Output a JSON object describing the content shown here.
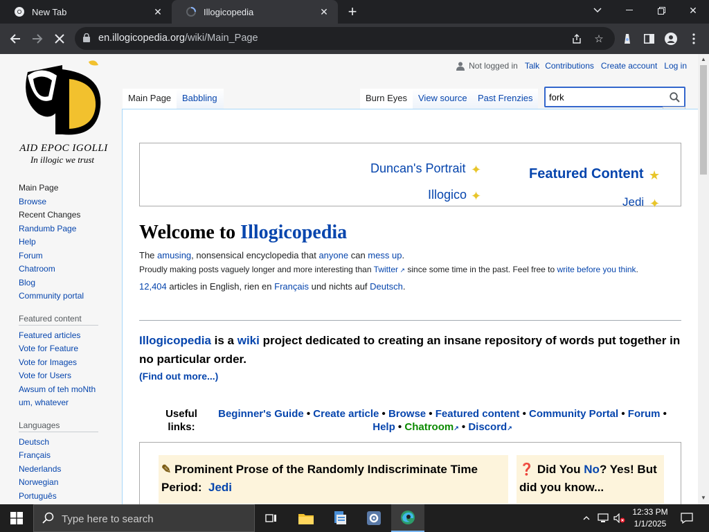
{
  "browser": {
    "tabs": [
      {
        "title": "New Tab"
      },
      {
        "title": "Illogicopedia"
      }
    ],
    "url": {
      "host": "en.illogicopedia.org",
      "path": "/wiki/Main_Page"
    }
  },
  "logo": {
    "motto": "AID EPOC IGOLLI",
    "tagline": "In illogic we trust"
  },
  "sidebar": {
    "nav": [
      "Main Page",
      "Browse",
      "Recent Changes",
      "Randumb Page",
      "Help",
      "Forum",
      "Chatroom",
      "Blog",
      "Community portal"
    ],
    "featured_header": "Featured content",
    "featured": [
      "Featured articles",
      "Vote for Feature",
      "Vote for Images",
      "Vote for Users",
      "Awsum of teh moNth",
      "um, whatever"
    ],
    "languages_header": "Languages",
    "languages": [
      "Deutsch",
      "Français",
      "Nederlands",
      "Norwegian",
      "Português"
    ]
  },
  "personal": {
    "not_logged_in": "Not logged in",
    "talk": "Talk",
    "contributions": "Contributions",
    "create_account": "Create account",
    "log_in": "Log in"
  },
  "page_tabs": {
    "main_page": "Main Page",
    "babbling": "Babbling",
    "burn_eyes": "Burn Eyes",
    "view_source": "View source",
    "past_frenzies": "Past Frenzies"
  },
  "search": {
    "value": "fork"
  },
  "banner": {
    "duncan": "Duncan's Portrait",
    "illogico": "Illogico",
    "featured": "Featured Content",
    "jedi": "Jedi"
  },
  "welcome": {
    "prefix": "Welcome to ",
    "name": "Illogicopedia"
  },
  "tagline": {
    "the": "The ",
    "amusing": "amusing",
    "mid1": ", nonsensical encyclopedia that ",
    "anyone": "anyone",
    "mid2": " can ",
    "mess_up": "mess up",
    "end": "."
  },
  "posts_line": {
    "text1": "Proudly making posts vaguely longer and more interesting than ",
    "twitter": "Twitter",
    "text2": " since some time in the past. Feel free to ",
    "write": "write before you think",
    "end": "."
  },
  "stats": {
    "count": "12,404",
    "text1": " articles in English, rien en ",
    "francais": "Français",
    "text2": " und nichts auf ",
    "deutsch": "Deutsch",
    "end": "."
  },
  "intro": {
    "name": "Illogicopedia",
    "is_a": " is a ",
    "wiki": "wiki",
    "rest": " project dedicated to creating an insane repository of words put together in no particular order."
  },
  "find_out_more": "(Find out more...)",
  "useful": {
    "label": "Useful links:",
    "links": [
      "Beginner's Guide",
      "Create article",
      "Browse",
      "Featured content",
      "Community Portal",
      "Forum",
      "Help",
      "Chatroom",
      "Discord"
    ],
    "sep": " • "
  },
  "boxes": {
    "prose_title": "Prominent Prose of the Randomly Indiscriminate Time Period:",
    "prose_link": "Jedi",
    "dyk_a": "Did You ",
    "dyk_no": "No",
    "dyk_b": "? Yes! But did you know..."
  },
  "taskbar": {
    "search_placeholder": "Type here to search",
    "time": "12:33 PM",
    "date": "1/1/2025"
  },
  "colors": {
    "link": "#0645ad",
    "chrome_bg": "#202124",
    "tab_active": "#35363a",
    "box_bg": "#fdf4dc"
  }
}
